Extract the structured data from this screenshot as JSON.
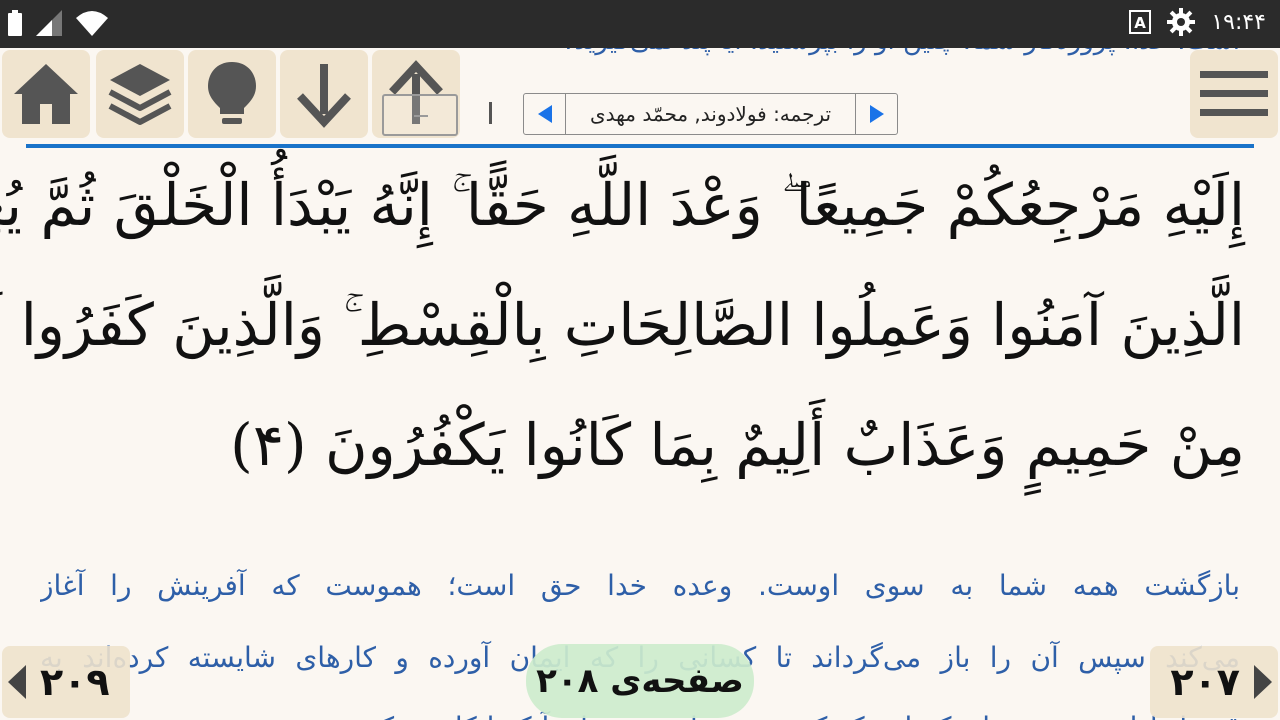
{
  "status_bar": {
    "time": "۱۹:۴۴",
    "icons": [
      "battery-icon",
      "signal-icon",
      "wifi-icon",
      "keyboard-icon",
      "settings-gear-icon"
    ]
  },
  "previous_translation_tail": "است. خدا، پروردگار شما، چنین او را بپرستید. آیا پند نمی‌گیرید؟",
  "toolbar": {
    "icons": [
      "home-icon",
      "layers-icon",
      "lightbulb-icon",
      "arrow-down-icon",
      "arrow-up-icon",
      "menu-icon"
    ],
    "translation_label": "ترجمه: فولادوند, محمّد مهدی"
  },
  "verse": {
    "line1": "إِلَيْهِ مَرْجِعُكُمْ جَمِيعًا ۖ وَعْدَ اللَّهِ حَقًّا ۚ إِنَّهُ يَبْدَأُ الْخَلْقَ ثُمَّ يُعِيدُهُ لِيَجْزِيَ",
    "line2": "الَّذِينَ آمَنُوا وَعَمِلُوا الصَّالِحَاتِ بِالْقِسْطِ ۚ وَالَّذِينَ كَفَرُوا لَهُمْ شَرَابٌ",
    "line3": "مِنْ حَمِيمٍ وَعَذَابٌ أَلِيمٌ بِمَا كَانُوا يَكْفُرُونَ (۴)"
  },
  "translation": {
    "line1": "بازگشت همه شما به سوی اوست. وعده خدا حق است؛ هموست که آفرینش را آغاز",
    "line2": "می‌کند سپس آن را باز می‌گرداند تا کسانی را که ایمان آورده و کارهای شایسته کرده‌اند به",
    "line3": "قسط پاداش دهد و برای کسانی که کفر ورزیده‌اند به سزای آنکه انکار می‌کردند"
  },
  "bottom_nav": {
    "prev_page": "۲۰۹",
    "next_page": "۲۰۷",
    "current_page": "صفحه‌ی ۲۰۸"
  },
  "colors": {
    "status_bar": "#2b2b2b",
    "page_bg": "#fbf7f2",
    "button_bg": "#f0e4cf",
    "accent_blue": "#1a73c9",
    "translation_text": "#2e5fa8",
    "page_pill": "#cdeccd"
  }
}
